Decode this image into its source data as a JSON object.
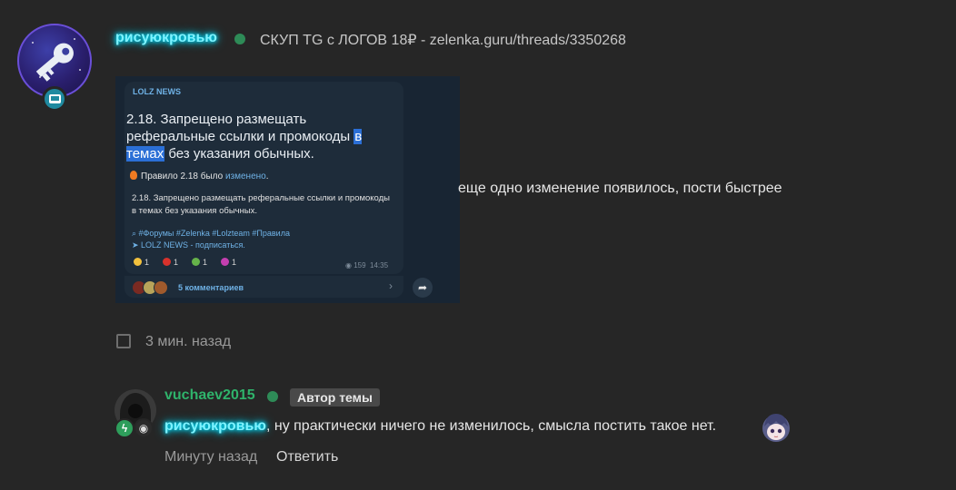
{
  "post": {
    "author": "рисуюкровью",
    "author_status": "online",
    "thread_title": "СКУП TG с ЛОГОВ 18₽ - zelenka.guru/threads/3350268",
    "text": "еще одно изменение появилось, пости быстрее",
    "time": "3 мин. назад",
    "colors": {
      "glow": "#00e5ff",
      "online": "#2e8b57"
    },
    "icons": [
      "key-avatar",
      "computer-badge-icon",
      "checkbox-icon"
    ]
  },
  "screenshot": {
    "channel": "LOLZ NEWS",
    "heading_before": "2.18. Запрещено размещать реферальные ссылки и промокоды ",
    "heading_highlight": "в темах",
    "heading_after": " без указания обычных.",
    "rule_line_prefix": "Правило 2.18 было ",
    "rule_line_link": "изменено",
    "rule_line_suffix": ".",
    "body": "2.18. Запрещено размещать реферальные ссылки и промокоды в темах без указания обычных.",
    "tags": "#Форумы #Zelenka #Lolzteam #Правила",
    "subscribe": "LOLZ NEWS - подписаться.",
    "reactions": [
      {
        "count": "1",
        "color": "#f2c13d"
      },
      {
        "count": "1",
        "color": "#d8322c"
      },
      {
        "count": "1",
        "color": "#66b34a"
      },
      {
        "count": "1",
        "color": "#c43fb0"
      }
    ],
    "views": "159",
    "time": "14:35",
    "comments": "5 комментариев"
  },
  "reply": {
    "author": "vuchaev2015",
    "author_status": "online",
    "badge": "Автор темы",
    "mention": "рисуюкровью",
    "text": ", ну практически ничего не изменилось, смысла постить такое нет.",
    "time": "Минуту назад",
    "reply_label": "Ответить",
    "colors": {
      "name": "#2fb36b",
      "badge_bg": "#494949"
    },
    "icons": [
      "hooded-avatar",
      "bolt-icon",
      "eye-icon",
      "anime-girl-emoji"
    ]
  }
}
